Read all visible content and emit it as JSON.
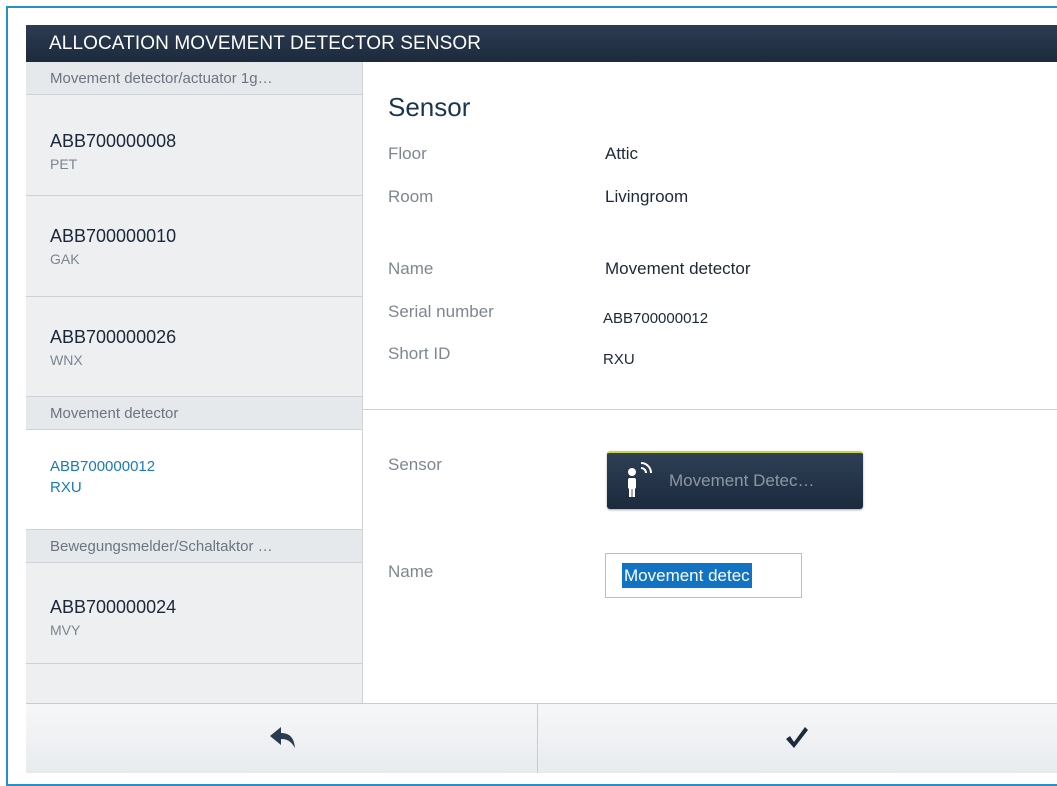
{
  "window": {
    "title": "ALLOCATION MOVEMENT DETECTOR SENSOR"
  },
  "sidebar": {
    "groups": [
      {
        "header": "Movement detector/actuator 1g…",
        "devices": [
          {
            "serial": "ABB700000008",
            "short_id": "PET"
          },
          {
            "serial": "ABB700000010",
            "short_id": "GAK"
          },
          {
            "serial": "ABB700000026",
            "short_id": "WNX"
          }
        ]
      },
      {
        "header": "Movement detector",
        "devices": [
          {
            "serial": "ABB700000012",
            "short_id": "RXU",
            "selected": true
          }
        ]
      },
      {
        "header": "Bewegungsmelder/Schaltaktor …",
        "devices": [
          {
            "serial": "ABB700000024",
            "short_id": "MVY"
          }
        ]
      }
    ]
  },
  "details": {
    "heading": "Sensor",
    "fields": {
      "floor": {
        "label": "Floor",
        "value": "Attic"
      },
      "room": {
        "label": "Room",
        "value": "Livingroom"
      },
      "name": {
        "label": "Name",
        "value": "Movement detector"
      },
      "serial": {
        "label": "Serial number",
        "value": "ABB700000012"
      },
      "short_id": {
        "label": "Short ID",
        "value": "RXU"
      }
    }
  },
  "config": {
    "sensor_label": "Sensor",
    "sensor_button_text": "Movement Detec…",
    "sensor_icon": "movement-detector-icon",
    "name_label": "Name",
    "name_input_value": "Movement detec"
  },
  "footer": {
    "back_icon": "back-arrow-icon",
    "confirm_icon": "checkmark-icon"
  },
  "colors": {
    "titlebar": "#1c2a3c",
    "accent": "#1a7ab8",
    "selection": "#1173c4",
    "frame": "#2a8fc4"
  }
}
